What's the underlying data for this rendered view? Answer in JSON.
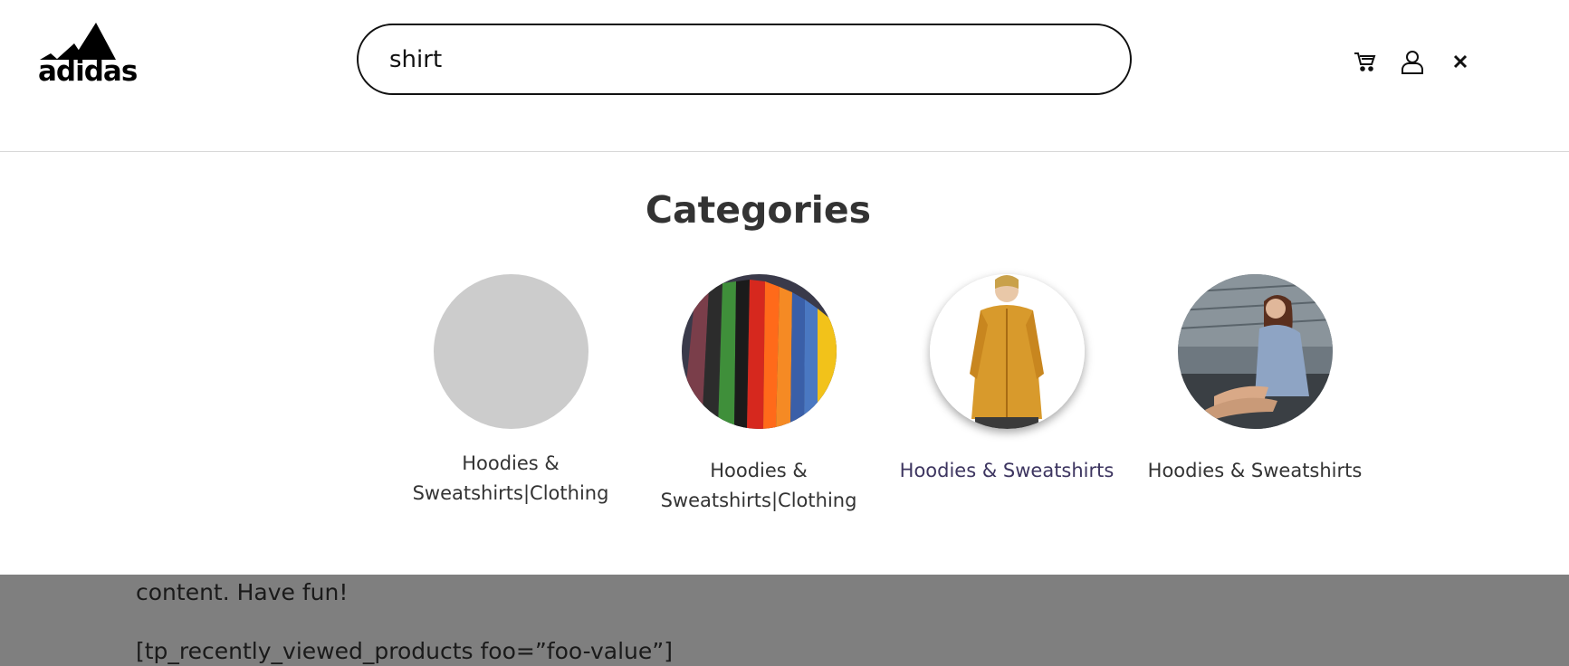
{
  "header": {
    "logo_text": "adidas",
    "search_value": "shirt",
    "icons": [
      "cart-icon",
      "user-icon",
      "close-icon"
    ]
  },
  "categories": {
    "title": "Categories",
    "items": [
      {
        "label": "Hoodies & Sweatshirts|Clothing",
        "image": "placeholder"
      },
      {
        "label": "Hoodies & Sweatshirts|Clothing",
        "image": "colorful-shirts"
      },
      {
        "label": "Hoodies & Sweatshirts",
        "image": "woman-orange-jacket"
      },
      {
        "label": "Hoodies & Sweatshirts",
        "image": "woman-blue-hoodie"
      }
    ]
  },
  "background": {
    "line1": "content. Have fun!",
    "line2": "[tp_recently_viewed_products foo=”foo-value”]"
  }
}
